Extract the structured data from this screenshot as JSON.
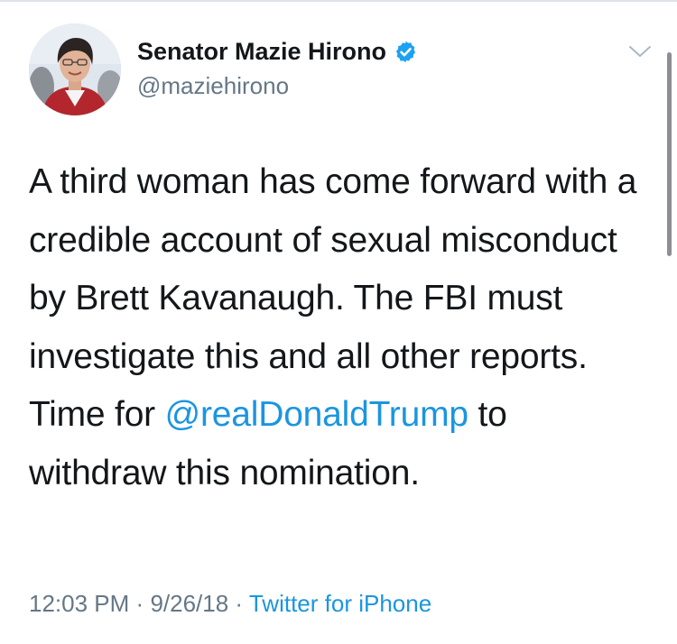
{
  "tweet": {
    "author": {
      "display_name": "Senator Mazie Hirono",
      "handle": "@maziehirono",
      "verified": true,
      "verified_icon": "verified-badge-icon"
    },
    "text": {
      "part1": "A third woman has come forward with a credible account of sexual misconduct by Brett Kavanaugh. The FBI must investigate this and all other reports. Time for ",
      "mention": "@realDonaldTrump",
      "part2": " to withdraw this nomination."
    },
    "time": "12:03 PM",
    "date": "9/26/18",
    "separator": "·",
    "source": "Twitter for iPhone",
    "menu_icon": "chevron-down-icon"
  },
  "colors": {
    "text": "#14171a",
    "secondary": "#657786",
    "link": "#1b95e0",
    "verified": "#1da1f2"
  }
}
